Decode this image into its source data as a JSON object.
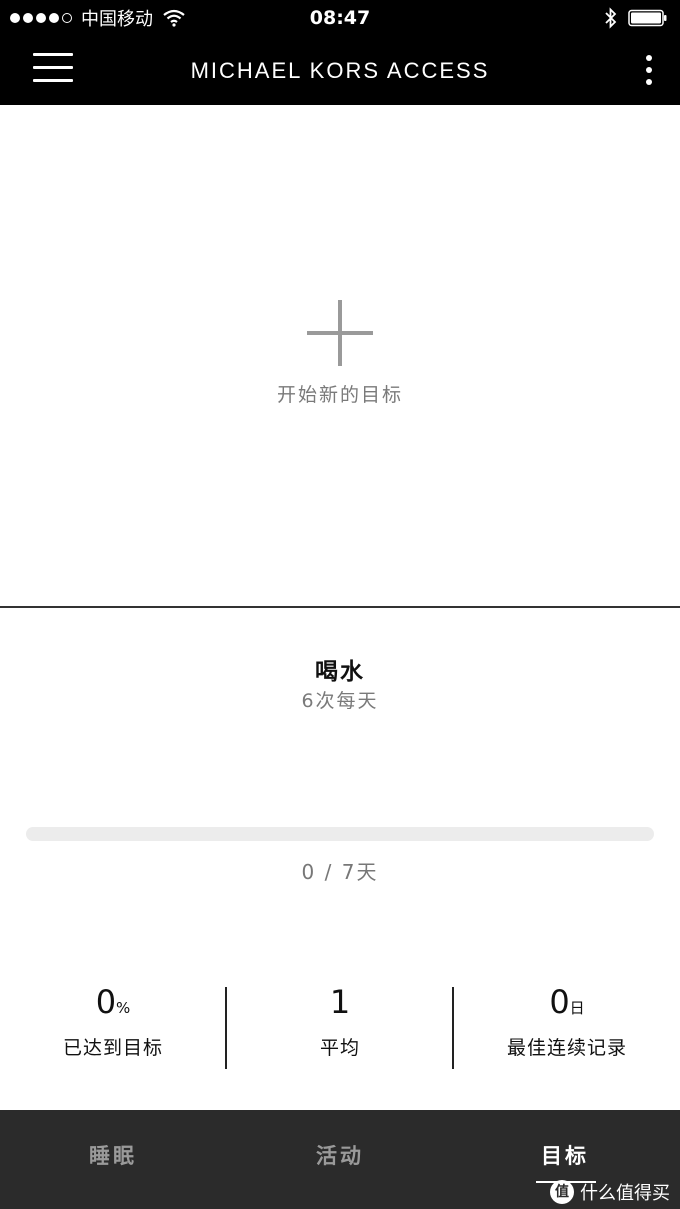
{
  "status_bar": {
    "carrier": "中国移动",
    "time": "08:47"
  },
  "header": {
    "title": "MICHAEL KORS ACCESS"
  },
  "new_goal": {
    "label": "开始新的目标"
  },
  "goal": {
    "title": "喝水",
    "frequency": "6次每天",
    "progress_fraction": 0,
    "progress_text": "0 / 7天"
  },
  "stats": [
    {
      "value": "0",
      "unit": "%",
      "label": "已达到目标"
    },
    {
      "value": "1",
      "unit": "",
      "label": "平均"
    },
    {
      "value": "0",
      "unit": "日",
      "label": "最佳连续记录"
    }
  ],
  "tabs": [
    {
      "label": "睡眠",
      "active": false
    },
    {
      "label": "活动",
      "active": false
    },
    {
      "label": "目标",
      "active": true
    }
  ],
  "watermark": {
    "logo_text": "值",
    "text": "什么值得买"
  },
  "colors": {
    "header_bg": "#000000",
    "tab_bar_bg": "#2b2b2b",
    "muted_text": "#7a7a7a"
  }
}
